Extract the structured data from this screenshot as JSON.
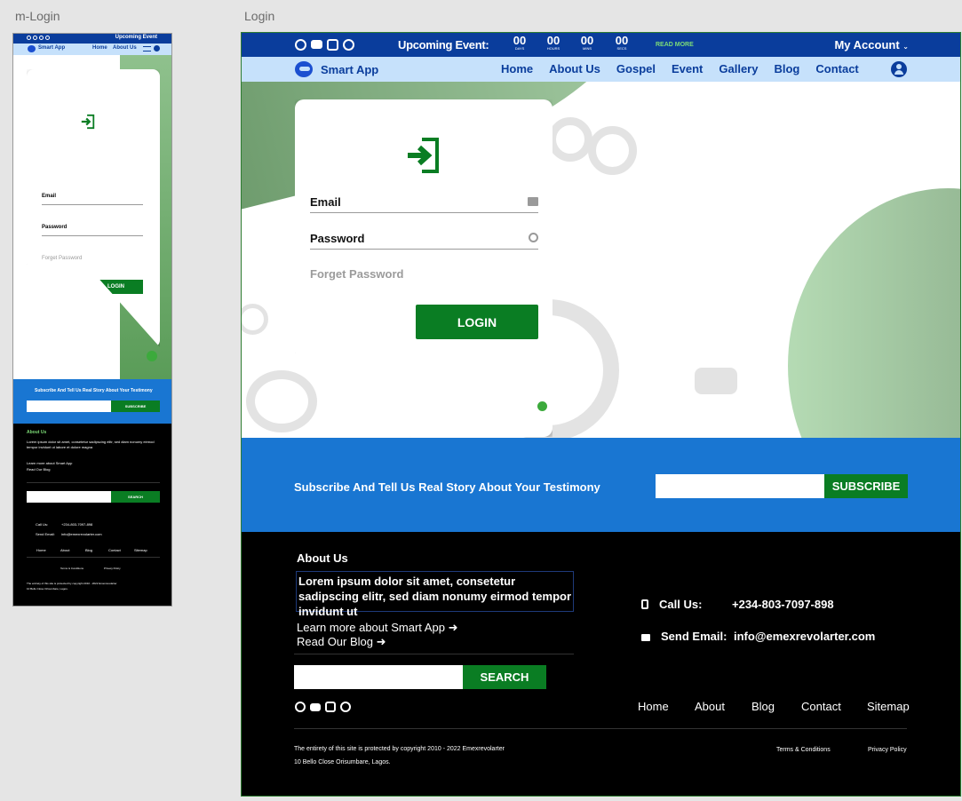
{
  "frames": {
    "mobile_label": "m-Login",
    "desktop_label": "Login"
  },
  "topbar": {
    "upcoming_label": "Upcoming Event:",
    "countdown": [
      {
        "value": "00",
        "unit": "DAYS"
      },
      {
        "value": "00",
        "unit": "HOURS"
      },
      {
        "value": "00",
        "unit": "MINS"
      },
      {
        "value": "00",
        "unit": "SECS"
      }
    ],
    "read_more": "READ MORE",
    "my_account": "My Account",
    "social_icons": [
      "facebook-icon",
      "youtube-icon",
      "instagram-icon",
      "whatsapp-icon"
    ]
  },
  "nav": {
    "brand": "Smart App",
    "links": [
      "Home",
      "About Us",
      "Gospel",
      "Event",
      "Gallery",
      "Blog",
      "Contact"
    ]
  },
  "login": {
    "email_label": "Email",
    "password_label": "Password",
    "forget_password": "Forget Password",
    "login_button": "LOGIN"
  },
  "subscribe": {
    "text": "Subscribe And Tell Us Real Story About Your Testimony",
    "button": "SUBSCRIBE"
  },
  "footer": {
    "about_heading": "About Us",
    "about_text": "Lorem ipsum dolor sit amet, consetetur sadipscing elitr, sed diam nonumy eirmod tempor invidunt ut",
    "learn_more": "Learn more about Smart App",
    "read_blog": "Read Our Blog",
    "search_button": "SEARCH",
    "call_label": "Call Us:",
    "call_value": "+234-803-7097-898",
    "email_label": "Send Email:",
    "email_value": "info@emexrevolarter.com",
    "nav": [
      "Home",
      "About",
      "Blog",
      "Contact",
      "Sitemap"
    ],
    "copyright": "The entirety of this site is protected by copyright  2010 - 2022 Emexrevolarter",
    "address": "10 Bello Close Orisumbare, Lagos.",
    "terms": "Terms & Conditions",
    "privacy": "Privacy Policy"
  },
  "mobile": {
    "upcoming_label": "Upcoming Event",
    "nav_links": [
      "Home",
      "About Us"
    ],
    "about_text": "Lorem ipsum dolor sit amet, consetetur sadipscing elitr, sed diam nonumy eirmod tempor invidunt ut labore et dolore magna",
    "nav": [
      "Home",
      "About",
      "Blog",
      "Contact",
      "Sitemap"
    ],
    "copyright": "The entirety of this site is protected by copyright  2010 - 2022 Emexrevolarter",
    "call_label": "Call Us:",
    "call_value": "+234-803-7097-898",
    "email_label": "Send Email:",
    "email_value": "info@emexrevolarter.com",
    "address": "10 Bello Close Orisumbare, Lagos."
  },
  "colors": {
    "navy": "#0a3d9c",
    "green": "#0a7d23",
    "blue": "#1976d2",
    "light_blue": "#c6e1fb"
  }
}
